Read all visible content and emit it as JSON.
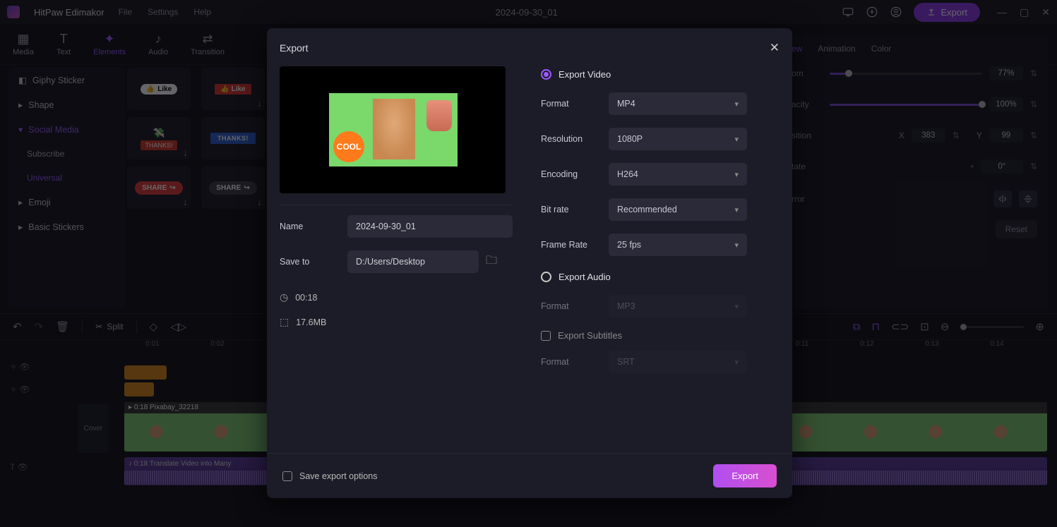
{
  "app": {
    "name": "HitPaw Edimakor"
  },
  "menubar": [
    "File",
    "Settings",
    "Help"
  ],
  "header": {
    "project": "2024-09-30_01",
    "export_btn": "Export"
  },
  "modetabs": [
    {
      "label": "Media"
    },
    {
      "label": "Text"
    },
    {
      "label": "Elements"
    },
    {
      "label": "Audio"
    },
    {
      "label": "Transition"
    }
  ],
  "sidebar": {
    "items": [
      "Giphy Sticker",
      "Shape",
      "Social Media",
      "Emoji",
      "Basic Stickers"
    ],
    "subs": [
      "Subscribe",
      "Universal"
    ]
  },
  "stickers": {
    "like": "Like",
    "like2": "Like",
    "thanks": "THANKS!",
    "thanks2": "THANKS!",
    "share": "SHARE",
    "share2": "SHARE"
  },
  "rightpanel": {
    "tabs": [
      "ew",
      "Animation",
      "Color"
    ],
    "zoom_lbl": "om",
    "zoom_val": "77%",
    "opacity_lbl": "acity",
    "opacity_val": "100%",
    "position_lbl": "sition",
    "x_lbl": "X",
    "x_val": "383",
    "y_lbl": "Y",
    "y_val": "99",
    "rotate_lbl": "tate",
    "rotate_val": "0°",
    "mirror_lbl": "rror",
    "reset": "Reset"
  },
  "toolbar": {
    "split": "Split"
  },
  "ruler": [
    "0:01",
    "0:02",
    "",
    "",
    "",
    "",
    "",
    "",
    "",
    "",
    "0:11",
    "0:12",
    "0:13",
    "0:14"
  ],
  "timeline": {
    "cover": "Cover",
    "video_clip": "0:18 Pixabay_32218",
    "audio_clip": "0:18 Translate Video into Many"
  },
  "modal": {
    "title": "Export",
    "name_lbl": "Name",
    "name_val": "2024-09-30_01",
    "save_lbl": "Save to",
    "save_val": "D:/Users/Desktop",
    "duration": "00:18",
    "size": "17.6MB",
    "video_hdr": "Export Video",
    "audio_hdr": "Export Audio",
    "subs_hdr": "Export Subtitles",
    "fields": {
      "format_lbl": "Format",
      "format_val": "MP4",
      "res_lbl": "Resolution",
      "res_val": "1080P",
      "enc_lbl": "Encoding",
      "enc_val": "H264",
      "bitrate_lbl": "Bit rate",
      "bitrate_val": "Recommended",
      "fps_lbl": "Frame Rate",
      "fps_val": "25  fps",
      "aformat_lbl": "Format",
      "aformat_val": "MP3",
      "sformat_lbl": "Format",
      "sformat_val": "SRT"
    },
    "saveopt": "Save export options",
    "export_btn": "Export"
  }
}
